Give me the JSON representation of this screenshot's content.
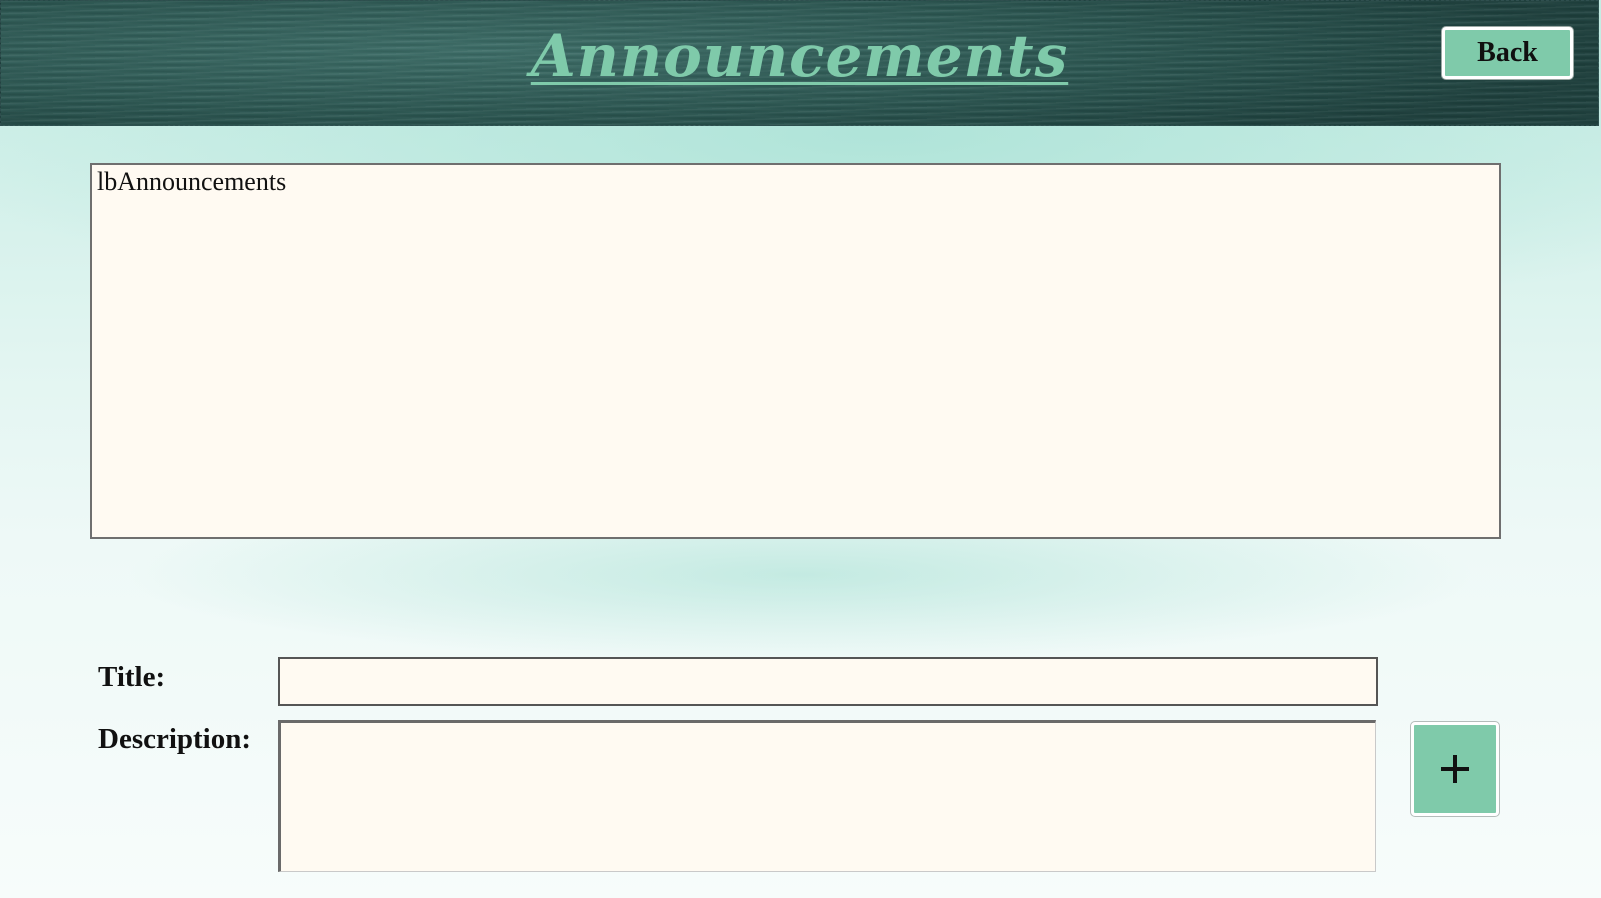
{
  "header": {
    "title": "Announcements",
    "back_label": "Back"
  },
  "listbox": {
    "text": "lbAnnouncements"
  },
  "form": {
    "title_label": "Title:",
    "title_value": "",
    "description_label": "Description:",
    "description_value": "",
    "add_icon": "plus-icon"
  },
  "colors": {
    "accent": "#7fcaaa",
    "header_bg": "#2a5550",
    "field_bg": "#fffaf2"
  }
}
